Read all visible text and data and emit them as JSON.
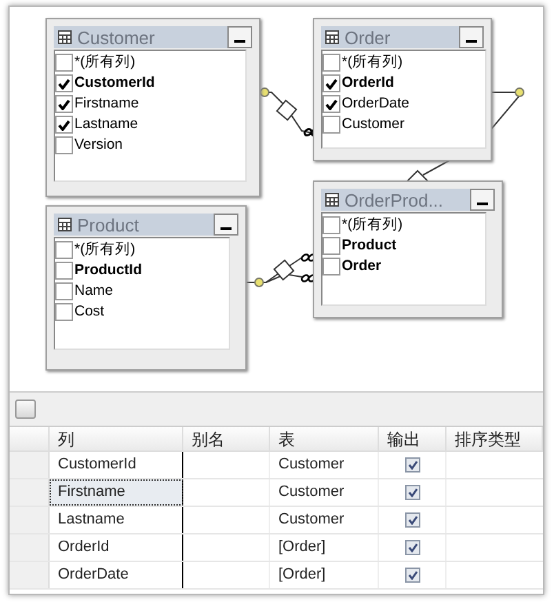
{
  "diagram": {
    "tables": [
      {
        "title": "Customer",
        "columns": [
          {
            "name": "*(所有列)",
            "checked": false,
            "key": false
          },
          {
            "name": "CustomerId",
            "checked": true,
            "key": true
          },
          {
            "name": "Firstname",
            "checked": true,
            "key": false
          },
          {
            "name": "Lastname",
            "checked": true,
            "key": false
          },
          {
            "name": "Version",
            "checked": false,
            "key": false
          }
        ]
      },
      {
        "title": "Order",
        "columns": [
          {
            "name": "*(所有列)",
            "checked": false,
            "key": false
          },
          {
            "name": "OrderId",
            "checked": true,
            "key": true
          },
          {
            "name": "OrderDate",
            "checked": true,
            "key": false
          },
          {
            "name": "Customer",
            "checked": false,
            "key": false
          }
        ]
      },
      {
        "title": "OrderProd...",
        "columns": [
          {
            "name": "*(所有列)",
            "checked": false,
            "key": false
          },
          {
            "name": "Product",
            "checked": false,
            "key": true
          },
          {
            "name": "Order",
            "checked": false,
            "key": true
          }
        ]
      },
      {
        "title": "Product",
        "columns": [
          {
            "name": "*(所有列)",
            "checked": false,
            "key": false
          },
          {
            "name": "ProductId",
            "checked": false,
            "key": true
          },
          {
            "name": "Name",
            "checked": false,
            "key": false
          },
          {
            "name": "Cost",
            "checked": false,
            "key": false
          }
        ]
      }
    ]
  },
  "grid": {
    "columns": [
      "列",
      "别名",
      "表",
      "输出",
      "排序类型"
    ],
    "rows": [
      {
        "column": "CustomerId",
        "table": "Customer",
        "output": true,
        "selected": false
      },
      {
        "column": "Firstname",
        "table": "Customer",
        "output": true,
        "selected": true
      },
      {
        "column": "Lastname",
        "table": "Customer",
        "output": true,
        "selected": false
      },
      {
        "column": "OrderId",
        "table": "[Order]",
        "output": true,
        "selected": false
      },
      {
        "column": "OrderDate",
        "table": "[Order]",
        "output": true,
        "selected": false
      }
    ]
  }
}
